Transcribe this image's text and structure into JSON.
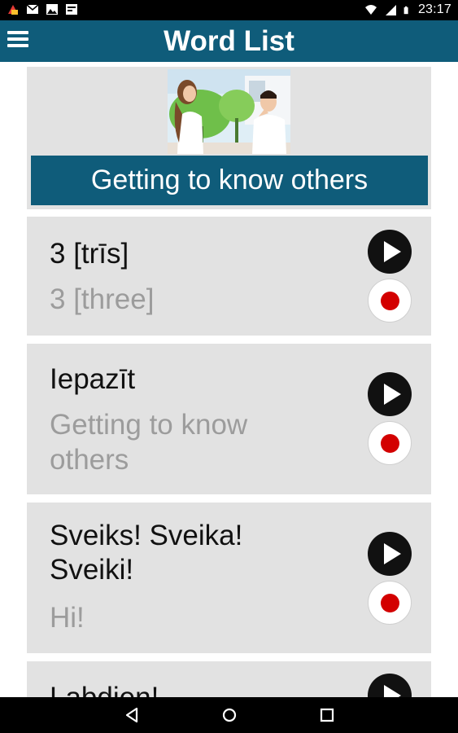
{
  "status_bar": {
    "time": "23:17",
    "left_icons": [
      "app-notification-icon",
      "gmail-icon",
      "image-icon",
      "keyboard-icon"
    ],
    "right_icons": [
      "wifi-icon",
      "signal-icon",
      "battery-icon"
    ]
  },
  "app_bar": {
    "title": "Word List",
    "menu_icon": "hamburger-menu-icon",
    "color": "#0f5c7a"
  },
  "lesson": {
    "title": "Getting to know others",
    "image": "two-people-talking-photo"
  },
  "words": [
    {
      "text": "3 [trīs]",
      "translation": "3 [three]"
    },
    {
      "text": "Iepazīt",
      "translation": "Getting to know others"
    },
    {
      "text": "Sveiks! Sveika! Sveiki!",
      "translation": "Hi!"
    },
    {
      "text": "Labdien!",
      "translation": ""
    }
  ],
  "controls": {
    "play_icon": "play-icon",
    "record_icon": "record-icon",
    "record_color": "#d30000"
  },
  "nav_bar": {
    "icons": [
      "back-icon",
      "home-icon",
      "recents-icon"
    ]
  }
}
